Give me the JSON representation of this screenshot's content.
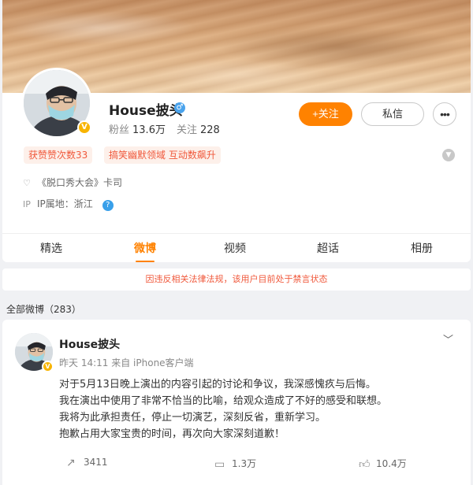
{
  "profile": {
    "name": "House披头",
    "gender_symbol": "♂",
    "verified_badge": "V",
    "followers_label": "粉丝",
    "followers_value": "13.6万",
    "following_label": "关注",
    "following_value": "228",
    "follow_button": "+关注",
    "message_button": "私信",
    "more_button": "•••",
    "tags": [
      "获赞赞次数33",
      "搞笑幽默领域 互动数飙升"
    ],
    "show_label": "《脱口秀大会》卡司",
    "ip_label": "IP属地：浙江",
    "help_icon": "?",
    "expand_icon": "chevron-down-icon"
  },
  "tabs": [
    {
      "label": "精选"
    },
    {
      "label": "微博"
    },
    {
      "label": "视频"
    },
    {
      "label": "超话"
    },
    {
      "label": "相册"
    }
  ],
  "active_tab": "微博",
  "notice": "因违反相关法律法规，该用户目前处于禁言状态",
  "weibo_count": "全部微博（283）",
  "post": {
    "author": "House披头",
    "time": "昨天 14:11",
    "source": "来自 iPhone客户端",
    "lines": [
      "对于5月13日晚上演出的内容引起的讨论和争议，我深感愧疚与后悔。",
      "我在演出中使用了非常不恰当的比喻，给观众造成了不好的感受和联想。",
      "我将为此承担责任，停止一切演艺，深刻反省，重新学习。",
      "抱歉占用大家宝贵的时间，再次向大家深刻道歉！"
    ],
    "reposts": "3411",
    "comments": "1.3万",
    "likes": "10.4万"
  },
  "colors": {
    "accent": "#ff8200",
    "notice_red": "#f0593c",
    "verified": "#f8b400",
    "link_blue": "#39a0ea"
  }
}
